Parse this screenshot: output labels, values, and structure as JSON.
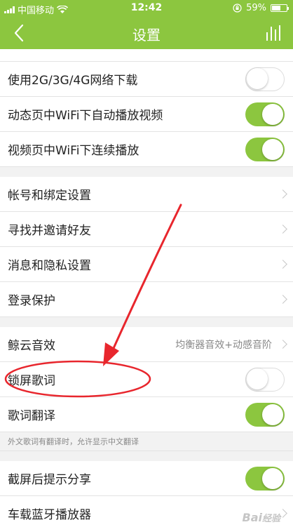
{
  "status_bar": {
    "carrier": "中国移动",
    "time": "12:42",
    "battery": "59%",
    "battery_level": 0.59
  },
  "header": {
    "title": "设置"
  },
  "sections": [
    [
      {
        "label": "使用2G/3G/4G网络下载",
        "control": "toggle",
        "on": false
      },
      {
        "label": "动态页中WiFi下自动播放视频",
        "control": "toggle",
        "on": true
      },
      {
        "label": "视频页中WiFi下连续播放",
        "control": "toggle",
        "on": true
      }
    ],
    [
      {
        "label": "帐号和绑定设置",
        "control": "chevron"
      },
      {
        "label": "寻找并邀请好友",
        "control": "chevron"
      },
      {
        "label": "消息和隐私设置",
        "control": "chevron"
      },
      {
        "label": "登录保护",
        "control": "chevron"
      }
    ],
    [
      {
        "label": "鲸云音效",
        "value": "均衡器音效+动感音阶",
        "control": "chevron"
      },
      {
        "label": "锁屏歌词",
        "control": "toggle",
        "on": false
      },
      {
        "label": "歌词翻译",
        "control": "toggle",
        "on": true
      }
    ],
    [
      {
        "label": "截屏后提示分享",
        "control": "toggle",
        "on": true
      },
      {
        "label": "车载蓝牙播放器",
        "control": "chevron"
      }
    ]
  ],
  "lyrics_translation_note": "外文歌词有翻译时，允许显示中文翻译",
  "watermark": "Bai 经验",
  "colors": {
    "accent": "#8cc63f",
    "annotation": "#e8262d"
  }
}
